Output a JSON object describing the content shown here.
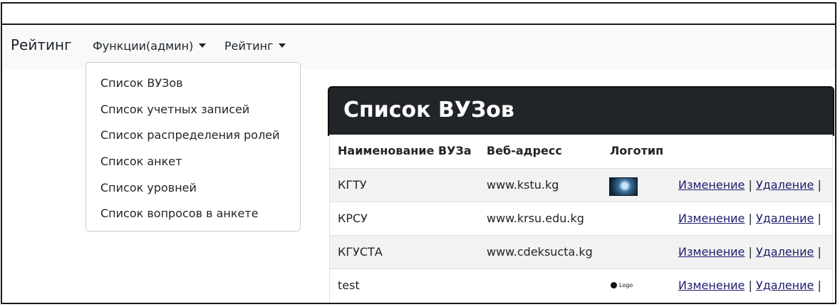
{
  "navbar": {
    "brand": "Рейтинг",
    "menus": [
      {
        "label": "Функции(админ)"
      },
      {
        "label": "Рейтинг"
      }
    ]
  },
  "dropdown": {
    "items": [
      "Список ВУЗов",
      "Список учетных записей",
      "Список распределения ролей",
      "Список анкет",
      "Список уровней",
      "Список вопросов в анкете"
    ]
  },
  "panel": {
    "title": "Список ВУЗов",
    "columns": [
      "Наименование ВУЗа",
      "Веб-адресс",
      "Логотип"
    ],
    "rows": [
      {
        "name": "КГТУ",
        "web": "www.kstu.kg",
        "logo": "globe-logo",
        "edit": "Изменение",
        "delete": "Удаление",
        "sep": "|"
      },
      {
        "name": "КРСУ",
        "web": "www.krsu.edu.kg",
        "logo": "",
        "edit": "Изменение",
        "delete": "Удаление",
        "sep": "|"
      },
      {
        "name": "КГУСТА",
        "web": "www.cdeksucta.kg",
        "logo": "",
        "edit": "Изменение",
        "delete": "Удаление",
        "sep": "|"
      },
      {
        "name": "test",
        "web": "",
        "logo": "Logo",
        "edit": "Изменение",
        "delete": "Удаление",
        "sep": "|"
      }
    ]
  }
}
